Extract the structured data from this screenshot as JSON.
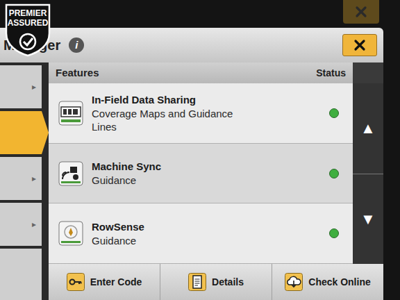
{
  "watermark": {
    "lines": [
      "PREMIER",
      "ASSURED"
    ]
  },
  "dialog": {
    "title": "Manager",
    "info": "i"
  },
  "sidebar": {
    "items": [
      {
        "arrow": "▸",
        "selected": false
      },
      {
        "arrow": "",
        "selected": true
      },
      {
        "arrow": "▸",
        "selected": false
      },
      {
        "arrow": "▸",
        "selected": false
      },
      {
        "arrow": "",
        "selected": false
      }
    ]
  },
  "table": {
    "columns": [
      "Features",
      "Status"
    ],
    "rows": [
      {
        "title": "In-Field Data Sharing",
        "subtitle": "Coverage Maps and Guidance Lines",
        "kind": "display",
        "status_color": "#3fae3f"
      },
      {
        "title": "Machine Sync",
        "subtitle": "Guidance",
        "kind": "sync",
        "status_color": "#3fae3f"
      },
      {
        "title": "RowSense",
        "subtitle": "Guidance",
        "kind": "rowsense",
        "status_color": "#3fae3f"
      }
    ]
  },
  "scroll": {
    "up": "▲",
    "down": "▼"
  },
  "buttons": [
    {
      "label": "Enter Code",
      "kind": "key"
    },
    {
      "label": "Details",
      "kind": "document"
    },
    {
      "label": "Check Online",
      "kind": "cloud"
    }
  ]
}
